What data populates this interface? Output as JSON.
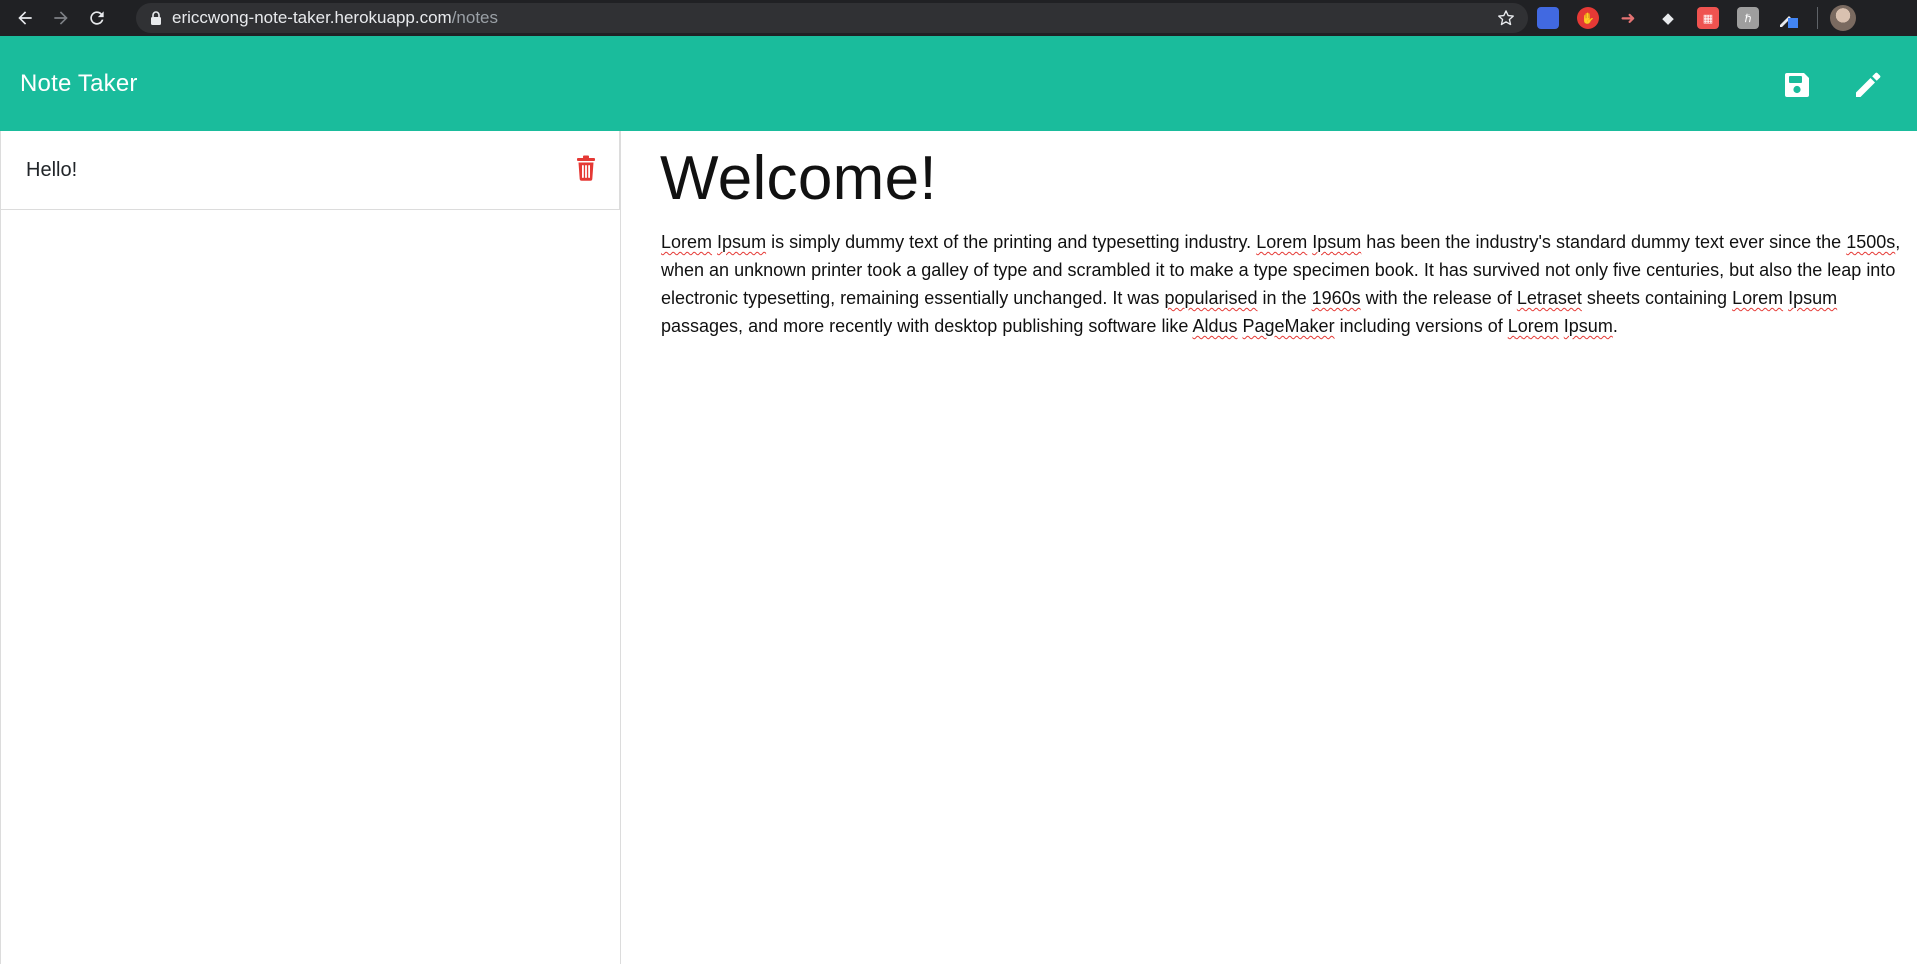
{
  "browser": {
    "url_host": "ericcwong-note-taker.herokuapp.com",
    "url_path": "/notes",
    "icons": [
      "back-icon",
      "forward-icon",
      "reload-icon",
      "lock-icon",
      "star-icon"
    ],
    "extensions": [
      {
        "name": "extension-blue-icon",
        "color": "#4169e1",
        "glyph": ""
      },
      {
        "name": "extension-hand-icon",
        "color": "#e53935",
        "glyph": "✋"
      },
      {
        "name": "extension-arrow-icon",
        "color": "#e57373",
        "glyph": "➜"
      },
      {
        "name": "extension-tag-icon",
        "color": "#bdbdbd",
        "glyph": "◆"
      },
      {
        "name": "extension-calendar-icon",
        "color": "#ef5350",
        "glyph": "▦"
      },
      {
        "name": "extension-gray-icon",
        "color": "#9e9e9e",
        "glyph": "ℏ"
      },
      {
        "name": "extension-pen-icon",
        "color": "#4285f4",
        "glyph": "✎"
      }
    ]
  },
  "app": {
    "title": "Note Taker",
    "accent_color": "#1abc9c",
    "header_icons": [
      "save-icon",
      "pencil-icon"
    ]
  },
  "notes": [
    {
      "title": "Hello!"
    }
  ],
  "active_note": {
    "title": "Welcome!",
    "body": "Lorem Ipsum is simply dummy text of the printing and typesetting industry. Lorem Ipsum has been the industry's standard dummy text ever since the 1500s, when an unknown printer took a galley of type and scrambled it to make a type specimen book. It has survived not only five centuries, but also the leap into electronic typesetting, remaining essentially unchanged. It was popularised in the 1960s with the release of Letraset sheets containing Lorem Ipsum passages, and more recently with desktop publishing software like Aldus PageMaker including versions of Lorem Ipsum."
  },
  "colors": {
    "delete_icon": "#e53935",
    "spellcheck_underline": "#e53935"
  }
}
